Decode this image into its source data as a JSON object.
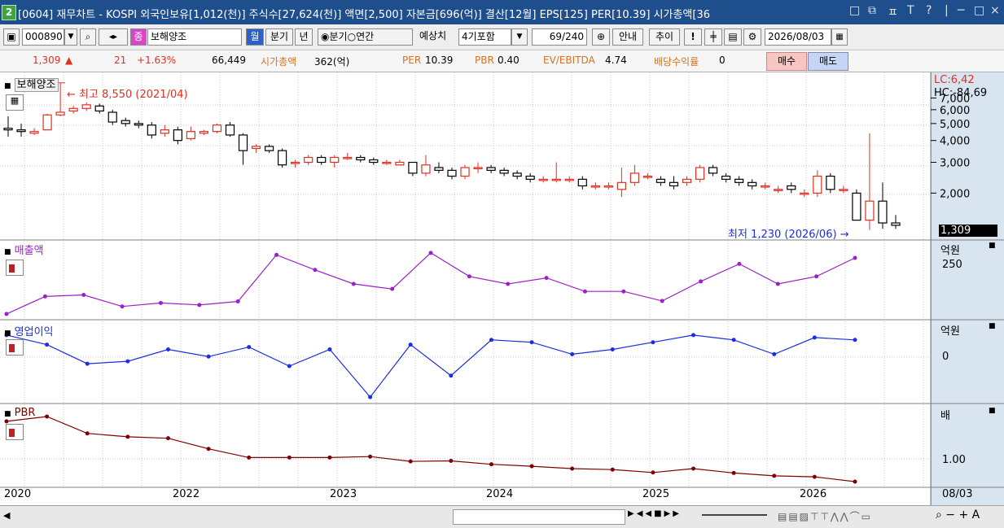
{
  "window": {
    "num": "2",
    "title": "[0604] 재무차트 - KOSPI 외국인보유[1,012(천)] 주식수[27,624(천)] 액면[2,500] 자본금[696(억)] 결산[12월] EPS[125] PER[10.39] 시가총액[36",
    "controls": [
      "□",
      "⧉",
      "ㅍ",
      "T",
      "?",
      "|",
      "─",
      "□",
      "×"
    ]
  },
  "toolbar": {
    "code": "000890",
    "stock_badge": "종",
    "stock_name": "보해양조",
    "month_btn": "월",
    "quarter_btn": "분기",
    "year_btn": "년",
    "radio_quarter": "분기",
    "radio_annual": "연간",
    "estimate_label": "예상치",
    "estimate_select": "4기포함",
    "counter": "69/240",
    "guide_btn": "안내",
    "trend_btn": "추이",
    "excl_btn": "!",
    "date": "2026/08/03"
  },
  "info": {
    "price": "1,309",
    "arrow": "▲",
    "change": "21",
    "change_pct": "+1.63%",
    "volume": "66,449",
    "mcap_label": "시가총액",
    "mcap_value": "362(억)",
    "per_label": "PER",
    "per_value": "10.39",
    "pbr_label": "PBR",
    "pbr_value": "0.40",
    "ev_label": "EV/EBITDA",
    "ev_value": "4.74",
    "div_label": "배당수익률",
    "div_value": "0",
    "buy_btn": "매수",
    "sell_btn": "매도"
  },
  "colors": {
    "up": "#e03020",
    "down": "#000000",
    "sales": "#9b20c8",
    "op": "#1a2ee0",
    "pbr": "#800000",
    "title": "#1f4e8c"
  },
  "chart_data": [
    {
      "type": "candlestick",
      "title": "보해양조",
      "annotation_high": "최고 8,550 (2021/04)",
      "annotation_low": "최저 1,230 (2026/06)",
      "lc": "LC:6,42",
      "hc": "HC:-84,69",
      "yticks": [
        "7,000",
        "6,000",
        "5,000",
        "4,000",
        "3,000",
        "2,000"
      ],
      "last_price": "1,309",
      "candles": [
        {
          "o": 4700,
          "c": 4600,
          "h": 5500,
          "l": 4200
        },
        {
          "o": 4600,
          "c": 4500,
          "h": 5000,
          "l": 4200
        },
        {
          "o": 4400,
          "c": 4500,
          "h": 4700,
          "l": 4300
        },
        {
          "o": 4600,
          "c": 5600,
          "h": 5700,
          "l": 4600
        },
        {
          "o": 5600,
          "c": 5800,
          "h": 8550,
          "l": 5500
        },
        {
          "o": 5900,
          "c": 6100,
          "h": 6300,
          "l": 5700
        },
        {
          "o": 6100,
          "c": 6400,
          "h": 6600,
          "l": 5900
        },
        {
          "o": 6300,
          "c": 5900,
          "h": 6500,
          "l": 5700
        },
        {
          "o": 5800,
          "c": 5100,
          "h": 6000,
          "l": 4900
        },
        {
          "o": 5200,
          "c": 5000,
          "h": 5400,
          "l": 4800
        },
        {
          "o": 5000,
          "c": 4900,
          "h": 5200,
          "l": 4700
        },
        {
          "o": 4900,
          "c": 4300,
          "h": 5100,
          "l": 4100
        },
        {
          "o": 4400,
          "c": 4600,
          "h": 4900,
          "l": 4200
        },
        {
          "o": 4600,
          "c": 4000,
          "h": 4800,
          "l": 3800
        },
        {
          "o": 4100,
          "c": 4500,
          "h": 4800,
          "l": 4000
        },
        {
          "o": 4400,
          "c": 4500,
          "h": 4600,
          "l": 4300
        },
        {
          "o": 4500,
          "c": 4900,
          "h": 5000,
          "l": 4400
        },
        {
          "o": 4900,
          "c": 4300,
          "h": 5100,
          "l": 4200
        },
        {
          "o": 4300,
          "c": 3500,
          "h": 4400,
          "l": 2900
        },
        {
          "o": 3600,
          "c": 3700,
          "h": 3800,
          "l": 3400
        },
        {
          "o": 3700,
          "c": 3500,
          "h": 3800,
          "l": 3400
        },
        {
          "o": 3500,
          "c": 2900,
          "h": 3600,
          "l": 2800
        },
        {
          "o": 3000,
          "c": 3000,
          "h": 3100,
          "l": 2800
        },
        {
          "o": 3000,
          "c": 3200,
          "h": 3300,
          "l": 2900
        },
        {
          "o": 3200,
          "c": 3000,
          "h": 3300,
          "l": 2900
        },
        {
          "o": 3000,
          "c": 3200,
          "h": 3300,
          "l": 2800
        },
        {
          "o": 3200,
          "c": 3200,
          "h": 3400,
          "l": 3100
        },
        {
          "o": 3200,
          "c": 3100,
          "h": 3300,
          "l": 3000
        },
        {
          "o": 3100,
          "c": 3000,
          "h": 3200,
          "l": 2900
        },
        {
          "o": 3000,
          "c": 3000,
          "h": 3100,
          "l": 2900
        },
        {
          "o": 2900,
          "c": 3000,
          "h": 3100,
          "l": 2900
        },
        {
          "o": 3000,
          "c": 2600,
          "h": 3000,
          "l": 2500
        },
        {
          "o": 2600,
          "c": 2900,
          "h": 3300,
          "l": 2500
        },
        {
          "o": 2800,
          "c": 2700,
          "h": 3000,
          "l": 2600
        },
        {
          "o": 2700,
          "c": 2500,
          "h": 2800,
          "l": 2400
        },
        {
          "o": 2500,
          "c": 2800,
          "h": 2900,
          "l": 2400
        },
        {
          "o": 2800,
          "c": 2800,
          "h": 3000,
          "l": 2600
        },
        {
          "o": 2800,
          "c": 2700,
          "h": 2900,
          "l": 2600
        },
        {
          "o": 2700,
          "c": 2600,
          "h": 2800,
          "l": 2500
        },
        {
          "o": 2600,
          "c": 2500,
          "h": 2700,
          "l": 2400
        },
        {
          "o": 2500,
          "c": 2400,
          "h": 2600,
          "l": 2300
        },
        {
          "o": 2400,
          "c": 2400,
          "h": 2500,
          "l": 2300
        },
        {
          "o": 2400,
          "c": 2400,
          "h": 3000,
          "l": 2300
        },
        {
          "o": 2400,
          "c": 2400,
          "h": 2500,
          "l": 2300
        },
        {
          "o": 2400,
          "c": 2200,
          "h": 2500,
          "l": 2100
        },
        {
          "o": 2200,
          "c": 2200,
          "h": 2300,
          "l": 2100
        },
        {
          "o": 2200,
          "c": 2200,
          "h": 2300,
          "l": 2100
        },
        {
          "o": 2100,
          "c": 2300,
          "h": 2800,
          "l": 1900
        },
        {
          "o": 2300,
          "c": 2600,
          "h": 2900,
          "l": 2200
        },
        {
          "o": 2500,
          "c": 2500,
          "h": 2600,
          "l": 2400
        },
        {
          "o": 2400,
          "c": 2300,
          "h": 2500,
          "l": 2200
        },
        {
          "o": 2300,
          "c": 2200,
          "h": 2500,
          "l": 2100
        },
        {
          "o": 2300,
          "c": 2400,
          "h": 2500,
          "l": 2200
        },
        {
          "o": 2400,
          "c": 2800,
          "h": 2900,
          "l": 2300
        },
        {
          "o": 2800,
          "c": 2600,
          "h": 2900,
          "l": 2500
        },
        {
          "o": 2500,
          "c": 2400,
          "h": 2600,
          "l": 2300
        },
        {
          "o": 2400,
          "c": 2300,
          "h": 2500,
          "l": 2200
        },
        {
          "o": 2300,
          "c": 2200,
          "h": 2400,
          "l": 2100
        },
        {
          "o": 2200,
          "c": 2200,
          "h": 2300,
          "l": 2100
        },
        {
          "o": 2100,
          "c": 2100,
          "h": 2200,
          "l": 2000
        },
        {
          "o": 2200,
          "c": 2100,
          "h": 2300,
          "l": 2000
        },
        {
          "o": 2000,
          "c": 2000,
          "h": 2100,
          "l": 1900
        },
        {
          "o": 2000,
          "c": 2500,
          "h": 2700,
          "l": 1900
        },
        {
          "o": 2500,
          "c": 2100,
          "h": 2600,
          "l": 2000
        },
        {
          "o": 2100,
          "c": 2100,
          "h": 2200,
          "l": 2000
        },
        {
          "o": 2000,
          "c": 1400,
          "h": 2100,
          "l": 1400
        },
        {
          "o": 1400,
          "c": 1800,
          "h": 4400,
          "l": 1230
        },
        {
          "o": 1800,
          "c": 1350,
          "h": 2300,
          "l": 1250
        },
        {
          "o": 1350,
          "c": 1309,
          "h": 1500,
          "l": 1250
        }
      ]
    },
    {
      "type": "line",
      "title": "매출액",
      "unit": "억원",
      "ytick": "250",
      "values": [
        140,
        175,
        178,
        155,
        162,
        158,
        165,
        258,
        228,
        200,
        190,
        262,
        215,
        200,
        212,
        185,
        185,
        166,
        205,
        240,
        200,
        215,
        252
      ]
    },
    {
      "type": "line",
      "title": "영업이익",
      "unit": "억원",
      "ytick": "0",
      "values": [
        8,
        4,
        -4,
        -3,
        2,
        -1,
        3,
        -5,
        2,
        -18,
        4,
        -9,
        6,
        5,
        0,
        2,
        5,
        8,
        6,
        0,
        7,
        6
      ]
    },
    {
      "type": "line",
      "title": "PBR",
      "unit": "배",
      "ytick": "1.00",
      "values": [
        1.75,
        1.85,
        1.5,
        1.43,
        1.4,
        1.18,
        1.0,
        1.0,
        1.0,
        1.02,
        0.92,
        0.93,
        0.86,
        0.82,
        0.77,
        0.75,
        0.69,
        0.77,
        0.68,
        0.62,
        0.6,
        0.5
      ],
      "xticks": [
        "2020",
        "2022",
        "2023",
        "2024",
        "2025",
        "2026"
      ],
      "xticks_right": "08/03"
    }
  ]
}
